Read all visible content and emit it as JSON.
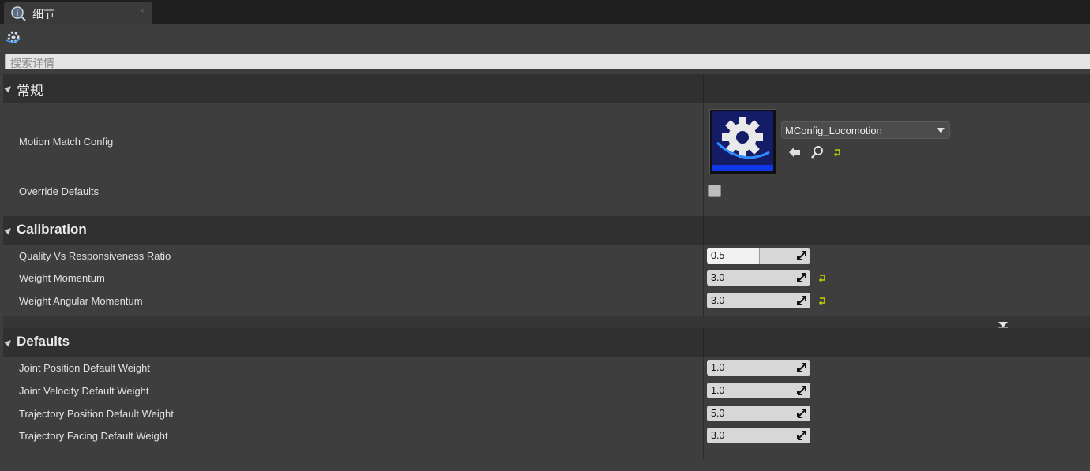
{
  "tab": {
    "title": "细节",
    "close": "×"
  },
  "search": {
    "placeholder": "搜索详情"
  },
  "categories": [
    {
      "title": "常规",
      "rows": [
        {
          "label": "Motion Match Config",
          "asset": "MConfig_Locomotion",
          "type": "asset"
        },
        {
          "label": "Override Defaults",
          "type": "checkbox",
          "checked": false
        }
      ]
    },
    {
      "title": "Calibration",
      "rows": [
        {
          "label": "Quality Vs Responsiveness Ratio",
          "value": "0.5",
          "slider_fraction": 0.5,
          "modified": false
        },
        {
          "label": "Weight Momentum",
          "value": "3.0",
          "modified": true
        },
        {
          "label": "Weight Angular Momentum",
          "value": "3.0",
          "modified": true
        }
      ]
    },
    {
      "title": "Defaults",
      "rows": [
        {
          "label": "Joint Position Default Weight",
          "value": "1.0"
        },
        {
          "label": "Joint Velocity Default Weight",
          "value": "1.0"
        },
        {
          "label": "Trajectory Position Default Weight",
          "value": "5.0"
        },
        {
          "label": "Trajectory Facing Default Weight",
          "value": "3.0"
        }
      ]
    }
  ],
  "colors": {
    "panel_bg": "#3e3e3e",
    "category_bg": "#303030",
    "number_box": "#d7d7d7",
    "reset_arrow": "#c8d400",
    "thumbnail_bg": "#141c68"
  },
  "icons": [
    "details-icon",
    "settings-icon",
    "browse-back-icon",
    "search-asset-icon",
    "reset-to-default-icon",
    "drag-value-icon",
    "expand-advanced-icon"
  ]
}
